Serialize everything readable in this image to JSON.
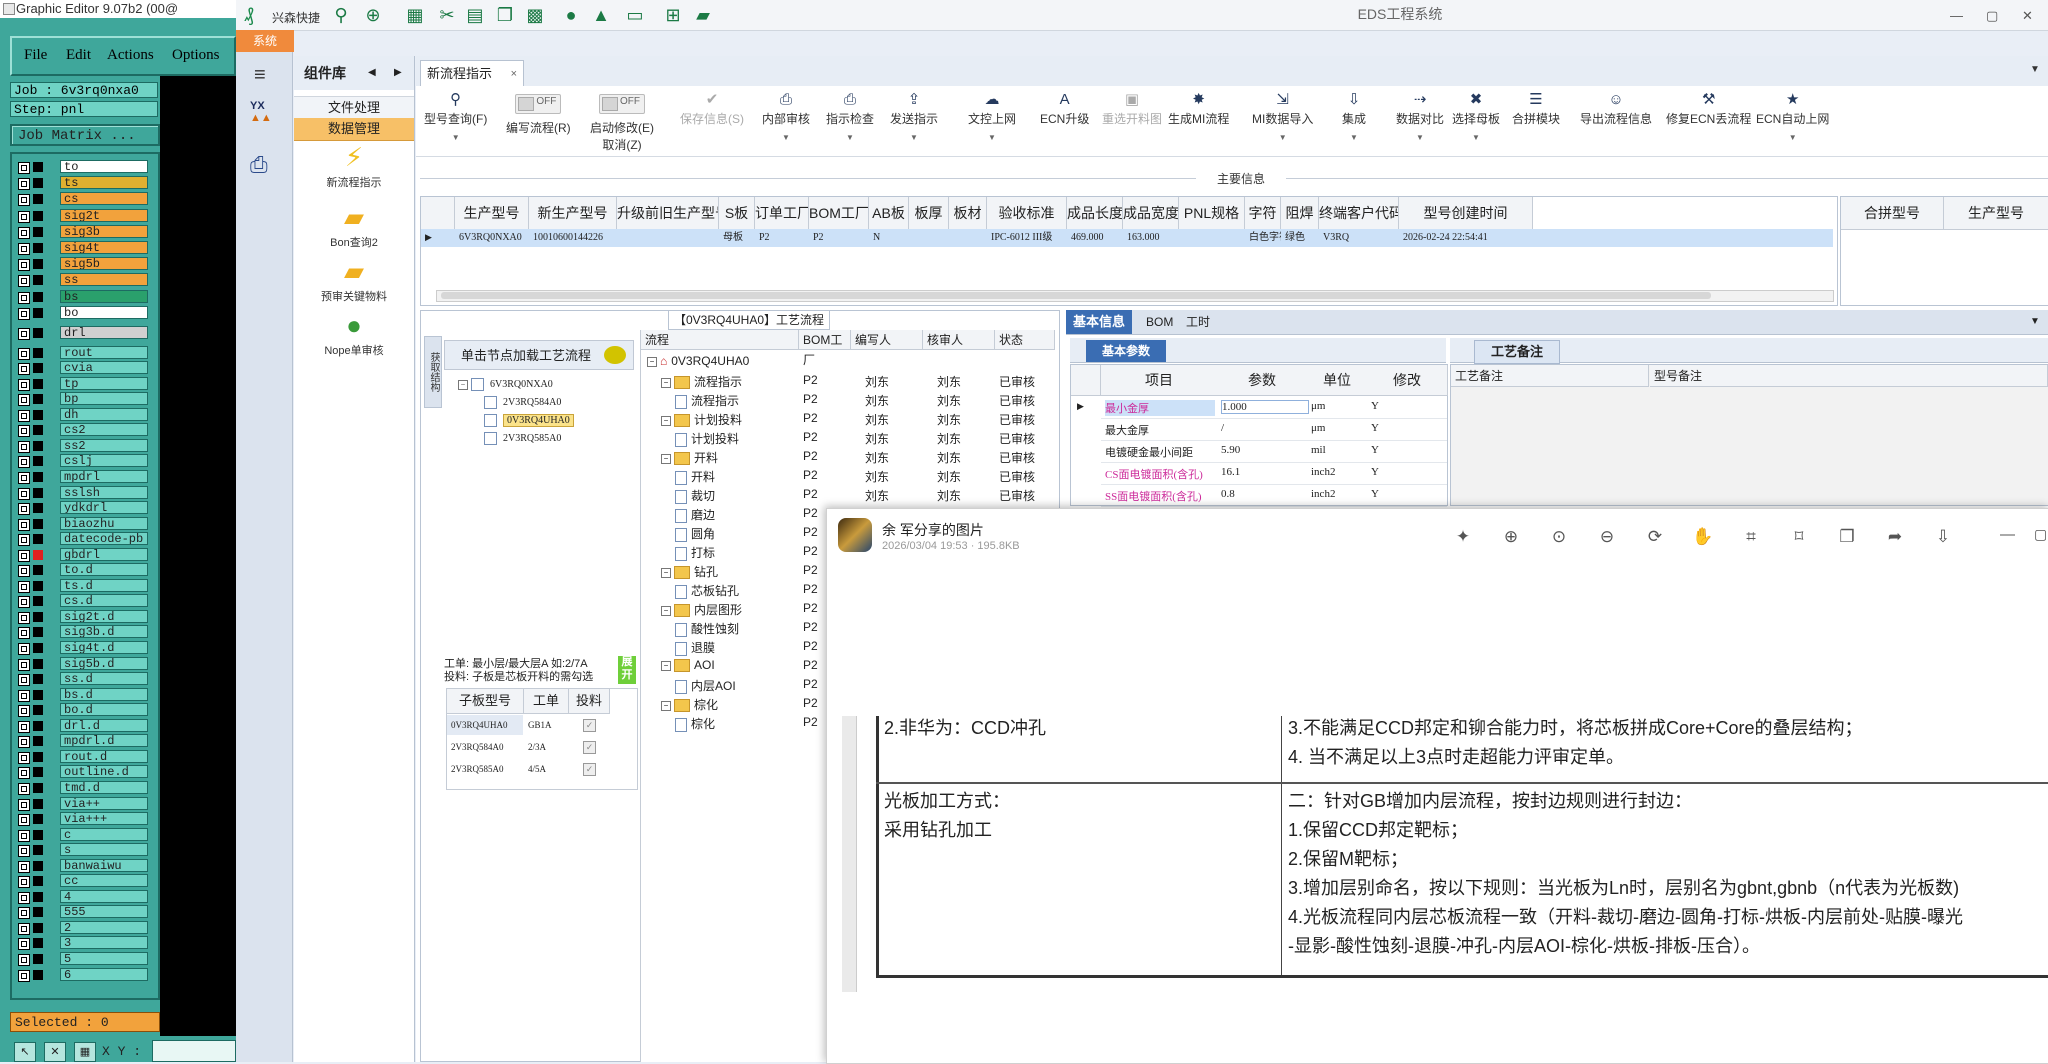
{
  "graphic_editor": {
    "title": "Graphic Editor 9.07b2 (00@",
    "menu": [
      "File",
      "Edit",
      "Actions",
      "Options"
    ],
    "job": "Job : 6v3rq0nxa0",
    "step": "Step: pnl",
    "job_matrix": "Job Matrix ...",
    "layers": [
      {
        "name": "to",
        "color": "#ffffff"
      },
      {
        "name": "ts",
        "color": "#e0b030"
      },
      {
        "name": "cs",
        "color": "#f2a23c"
      },
      {
        "name": "sig2t",
        "color": "#f2a23c"
      },
      {
        "name": "sig3b",
        "color": "#f2a23c"
      },
      {
        "name": "sig4t",
        "color": "#f2a23c"
      },
      {
        "name": "sig5b",
        "color": "#f2a23c"
      },
      {
        "name": "ss",
        "color": "#f2a23c"
      },
      {
        "name": "bs",
        "color": "#2aa06c"
      },
      {
        "name": "bo",
        "color": "#ffffff"
      },
      {
        "name": "drl",
        "color": "#d0d0d0"
      },
      {
        "name": "rout",
        "color": "#6fd3c5"
      },
      {
        "name": "cvia",
        "color": "#6fd3c5"
      },
      {
        "name": "tp",
        "color": "#6fd3c5"
      },
      {
        "name": "bp",
        "color": "#6fd3c5"
      },
      {
        "name": "dh",
        "color": "#6fd3c5"
      },
      {
        "name": "cs2",
        "color": "#6fd3c5"
      },
      {
        "name": "ss2",
        "color": "#6fd3c5"
      },
      {
        "name": "cslj",
        "color": "#6fd3c5"
      },
      {
        "name": "mpdrl",
        "color": "#6fd3c5"
      },
      {
        "name": "sslsh",
        "color": "#6fd3c5"
      },
      {
        "name": "ydkdrl",
        "color": "#6fd3c5"
      },
      {
        "name": "biaozhu",
        "color": "#6fd3c5"
      },
      {
        "name": "datecode-pb",
        "color": "#6fd3c5"
      },
      {
        "name": "gbdrl",
        "color": "#6fd3c5"
      },
      {
        "name": "to.d",
        "color": "#6fd3c5"
      },
      {
        "name": "ts.d",
        "color": "#6fd3c5"
      },
      {
        "name": "cs.d",
        "color": "#6fd3c5"
      },
      {
        "name": "sig2t.d",
        "color": "#6fd3c5"
      },
      {
        "name": "sig3b.d",
        "color": "#6fd3c5"
      },
      {
        "name": "sig4t.d",
        "color": "#6fd3c5"
      },
      {
        "name": "sig5b.d",
        "color": "#6fd3c5"
      },
      {
        "name": "ss.d",
        "color": "#6fd3c5"
      },
      {
        "name": "bs.d",
        "color": "#6fd3c5"
      },
      {
        "name": "bo.d",
        "color": "#6fd3c5"
      },
      {
        "name": "drl.d",
        "color": "#6fd3c5"
      },
      {
        "name": "mpdrl.d",
        "color": "#6fd3c5"
      },
      {
        "name": "rout.d",
        "color": "#6fd3c5"
      },
      {
        "name": "outline.d",
        "color": "#6fd3c5"
      },
      {
        "name": "tmd.d",
        "color": "#6fd3c5"
      },
      {
        "name": "via++",
        "color": "#6fd3c5"
      },
      {
        "name": "via+++",
        "color": "#6fd3c5"
      },
      {
        "name": "c",
        "color": "#6fd3c5"
      },
      {
        "name": "s",
        "color": "#6fd3c5"
      },
      {
        "name": "banwaiwu",
        "color": "#6fd3c5"
      },
      {
        "name": "cc",
        "color": "#6fd3c5"
      },
      {
        "name": "4",
        "color": "#6fd3c5"
      },
      {
        "name": "555",
        "color": "#6fd3c5"
      },
      {
        "name": "2",
        "color": "#6fd3c5"
      },
      {
        "name": "3",
        "color": "#6fd3c5"
      },
      {
        "name": "5",
        "color": "#6fd3c5"
      },
      {
        "name": "6",
        "color": "#6fd3c5"
      }
    ],
    "selected": "Selected : 0",
    "coord_label": "X Y :"
  },
  "eds": {
    "quick_label": "兴森快捷",
    "app_title": "EDS工程系统",
    "system_tab": "系统",
    "component_lib": "组件库",
    "btn_file_process": "文件处理",
    "btn_data_manage": "数据管理",
    "items": [
      "新流程指示",
      "Bon查询2",
      "预审关键物料",
      "Nope单审核"
    ],
    "doc_tab": "新流程指示",
    "toolbar": [
      {
        "label": "型号查询(F)",
        "icon": "search-icon",
        "dropdown": true
      },
      {
        "label": "编写流程(R)",
        "toggle": "OFF"
      },
      {
        "label": "启动修改(E)",
        "label2": "取消(Z)",
        "toggle": "OFF"
      },
      {
        "label": "保存信息(S)",
        "disabled": true
      },
      {
        "label": "内部审核",
        "dropdown": true
      },
      {
        "label": "指示检查",
        "dropdown": true
      },
      {
        "label": "发送指示",
        "dropdown": true
      },
      {
        "label": "文控上网",
        "dropdown": true
      },
      {
        "label": "ECN升级"
      },
      {
        "label": "重选开料图",
        "disabled": true
      },
      {
        "label": "生成MI流程"
      },
      {
        "label": "MI数据导入",
        "dropdown": true
      },
      {
        "label": "集成",
        "dropdown": true
      },
      {
        "label": "数据对比",
        "dropdown": true
      },
      {
        "label": "选择母板",
        "dropdown": true
      },
      {
        "label": "合拼模块"
      },
      {
        "label": "导出流程信息"
      },
      {
        "label": "修复ECN丢流程"
      },
      {
        "label": "ECN自动上网",
        "dropdown": true
      }
    ],
    "main_info_label": "主要信息",
    "main_grid": {
      "headers": [
        "生产型号",
        "新生产型号",
        "升级前旧生产型号",
        "S板",
        "订单工厂",
        "BOM工厂",
        "AB板",
        "板厚",
        "板材",
        "验收标准",
        "成品长度",
        "成品宽度",
        "PNL规格",
        "字符",
        "阻焊",
        "终端客户代码",
        "型号创建时间"
      ],
      "row": [
        "6V3RQ0NXA0",
        "10010600144226",
        "",
        "母板",
        "P2",
        "P2",
        "N",
        "",
        "",
        "IPC-6012 III级",
        "469.000",
        "163.000",
        "",
        "白色字符",
        "绿色",
        "V3RQ",
        "2026-02-24 22:54:41"
      ]
    },
    "merge_grid_headers": [
      "合拼型号",
      "生产型号"
    ],
    "process_panel": {
      "title": "【0V3RQ4UHA0】工艺流程",
      "vtab": "获取结构",
      "load_btn": "单击节点加载工艺流程",
      "tree": [
        "6V3RQ0NXA0",
        "2V3RQ584A0",
        "0V3RQ4UHA0",
        "2V3RQ585A0"
      ],
      "info_line1": "工单: 最小层/最大层A 如:2/7A",
      "info_line2": "投料: 子板是芯板开料的需勾选",
      "expand_btn": "展开",
      "sub_headers": [
        "子板型号",
        "工单",
        "投料"
      ],
      "sub_rows": [
        [
          "0V3RQ4UHA0",
          "GB1A"
        ],
        [
          "2V3RQ584A0",
          "2/3A"
        ],
        [
          "2V3RQ585A0",
          "4/5A"
        ]
      ],
      "flow_headers": [
        "流程",
        "BOM工厂",
        "编写人",
        "核审人",
        "状态"
      ],
      "flow_rows": [
        {
          "name": "0V3RQ4UHA0",
          "level": 0,
          "type": "root",
          "factory": "",
          "writer": "",
          "reviewer": "",
          "status": ""
        },
        {
          "name": "流程指示",
          "level": 1,
          "type": "folder",
          "factory": "P2",
          "writer": "刘东",
          "reviewer": "刘东",
          "status": "已审核"
        },
        {
          "name": "流程指示",
          "level": 2,
          "type": "doc",
          "factory": "P2",
          "writer": "刘东",
          "reviewer": "刘东",
          "status": "已审核"
        },
        {
          "name": "计划投料",
          "level": 1,
          "type": "folder",
          "factory": "P2",
          "writer": "刘东",
          "reviewer": "刘东",
          "status": "已审核"
        },
        {
          "name": "计划投料",
          "level": 2,
          "type": "doc",
          "factory": "P2",
          "writer": "刘东",
          "reviewer": "刘东",
          "status": "已审核"
        },
        {
          "name": "开料",
          "level": 1,
          "type": "folder",
          "factory": "P2",
          "writer": "刘东",
          "reviewer": "刘东",
          "status": "已审核"
        },
        {
          "name": "开料",
          "level": 2,
          "type": "doc",
          "factory": "P2",
          "writer": "刘东",
          "reviewer": "刘东",
          "status": "已审核"
        },
        {
          "name": "裁切",
          "level": 2,
          "type": "doc",
          "factory": "P2",
          "writer": "刘东",
          "reviewer": "刘东",
          "status": "已审核"
        },
        {
          "name": "磨边",
          "level": 2,
          "type": "doc",
          "factory": "P2",
          "writer": "",
          "reviewer": "",
          "status": ""
        },
        {
          "name": "圆角",
          "level": 2,
          "type": "doc",
          "factory": "P2",
          "writer": "",
          "reviewer": "",
          "status": ""
        },
        {
          "name": "打标",
          "level": 2,
          "type": "doc",
          "factory": "P2",
          "writer": "",
          "reviewer": "",
          "status": ""
        },
        {
          "name": "钻孔",
          "level": 1,
          "type": "folder",
          "factory": "P2",
          "writer": "",
          "reviewer": "",
          "status": ""
        },
        {
          "name": "芯板钻孔",
          "level": 2,
          "type": "doc",
          "factory": "P2",
          "writer": "",
          "reviewer": "",
          "status": ""
        },
        {
          "name": "内层图形",
          "level": 1,
          "type": "folder",
          "factory": "P2",
          "writer": "",
          "reviewer": "",
          "status": ""
        },
        {
          "name": "酸性蚀刻",
          "level": 2,
          "type": "doc",
          "factory": "P2",
          "writer": "",
          "reviewer": "",
          "status": ""
        },
        {
          "name": "退膜",
          "level": 2,
          "type": "doc",
          "factory": "P2",
          "writer": "",
          "reviewer": "",
          "status": ""
        },
        {
          "name": "AOI",
          "level": 1,
          "type": "folder",
          "factory": "P2",
          "writer": "",
          "reviewer": "",
          "status": ""
        },
        {
          "name": "内层AOI",
          "level": 2,
          "type": "doc",
          "factory": "P2",
          "writer": "",
          "reviewer": "",
          "status": ""
        },
        {
          "name": "棕化",
          "level": 1,
          "type": "folder",
          "factory": "P2",
          "writer": "",
          "reviewer": "",
          "status": ""
        },
        {
          "name": "棕化",
          "level": 2,
          "type": "doc",
          "factory": "P2",
          "writer": "",
          "reviewer": "",
          "status": ""
        }
      ]
    },
    "info_panel": {
      "tabs": [
        "基本信息",
        "BOM",
        "工时"
      ],
      "param_label": "基本参数",
      "param_headers": [
        "项目",
        "参数",
        "单位",
        "修改"
      ],
      "param_rows": [
        {
          "item": "最小金厚",
          "value": "1.000",
          "unit": "μm",
          "mod": "Y",
          "color": "#cc2a9a"
        },
        {
          "item": "最大金厚",
          "value": "/",
          "unit": "μm",
          "mod": "Y",
          "color": "#222222"
        },
        {
          "item": "电镀硬金最小间距",
          "value": "5.90",
          "unit": "mil",
          "mod": "Y",
          "color": "#222222"
        },
        {
          "item": "CS面电镀面积(含孔)",
          "value": "16.1",
          "unit": "inch2",
          "mod": "Y",
          "color": "#cc2a9a"
        },
        {
          "item": "SS面电镀面积(含孔)",
          "value": "0.8",
          "unit": "inch2",
          "mod": "Y",
          "color": "#cc2a9a"
        }
      ],
      "craft_label": "工艺备注",
      "craft_headers": [
        "工艺备注",
        "型号备注"
      ]
    }
  },
  "viewer": {
    "title": "余 军分享的图片",
    "meta": "2026/03/04 19:53 · 195.8KB",
    "icons": [
      "magic-icon",
      "zoom-in-icon",
      "fit-icon",
      "zoom-out-icon",
      "rotate-icon",
      "hand-icon",
      "crop-icon",
      "scan-icon",
      "copy-icon",
      "share-icon",
      "download-icon"
    ],
    "image_text": {
      "left_top": "2.非华为：CCD冲孔",
      "right_top1": "3.不能满足CCD邦定和铆合能力时，将芯板拼成Core+Core的叠层结构；",
      "right_top2": "4. 当不满足以上3点时走超能力评审定单。",
      "left_mid1": "光板加工方式：",
      "left_mid2": "采用钻孔加工",
      "right_mid": [
        "二：针对GB增加内层流程，按封边规则进行封边：",
        "1.保留CCD邦定靶标；",
        "2.保留M靶标；",
        "3.增加层别命名，按以下规则：当光板为Ln时，层别名为gbnt,gbnb（n代表为光板数)",
        "4.光板流程同内层芯板流程一致（开料-裁切-磨边-圆角-打标-烘板-内层前处-贴膜-曝光",
        "-显影-酸性蚀刻-退膜-冲孔-内层AOI-棕化-烘板-排板-压合）。"
      ]
    }
  }
}
